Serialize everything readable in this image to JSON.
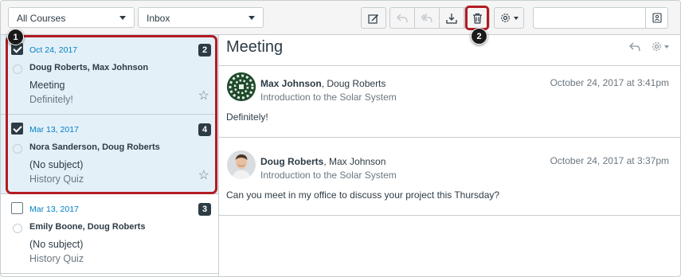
{
  "toolbar": {
    "course_filter": "All Courses",
    "mailbox_filter": "Inbox",
    "compose_icon": "compose-icon",
    "reply_icon": "reply-icon",
    "reply_all_icon": "reply-all-icon",
    "archive_icon": "archive-icon",
    "delete_icon": "trash-icon",
    "settings_icon": "gear-icon",
    "search_placeholder": "",
    "search_icon": "address-book-icon"
  },
  "messages": [
    {
      "date": "Oct 24, 2017",
      "count": "2",
      "people": "Doug Roberts, Max Johnson",
      "subject": "Meeting",
      "preview": "Definitely!",
      "checked": true,
      "selected": true
    },
    {
      "date": "Mar 13, 2017",
      "count": "4",
      "people": "Nora Sanderson, Doug Roberts",
      "subject": "(No subject)",
      "preview": "History Quiz",
      "checked": true,
      "selected": true
    },
    {
      "date": "Mar 13, 2017",
      "count": "3",
      "people": "Emily Boone, Doug Roberts",
      "subject": "(No subject)",
      "preview": "History Quiz",
      "checked": false,
      "selected": false
    }
  ],
  "callouts": [
    "1",
    "2"
  ],
  "conversation": {
    "title": "Meeting",
    "entries": [
      {
        "author": "Max Johnson",
        "participants": ", Doug Roberts",
        "course": "Introduction to the Solar System",
        "timestamp": "October 24, 2017 at 3:41pm",
        "body": "Definitely!"
      },
      {
        "author": "Doug Roberts",
        "participants": ", Max Johnson",
        "course": "Introduction to the Solar System",
        "timestamp": "October 24, 2017 at 3:37pm",
        "body": "Can you meet in my office to discuss your project this Thursday?"
      }
    ]
  },
  "colors": {
    "accent": "#0081c6",
    "highlight": "#b31b22",
    "selected_bg": "#e4f0f8"
  }
}
